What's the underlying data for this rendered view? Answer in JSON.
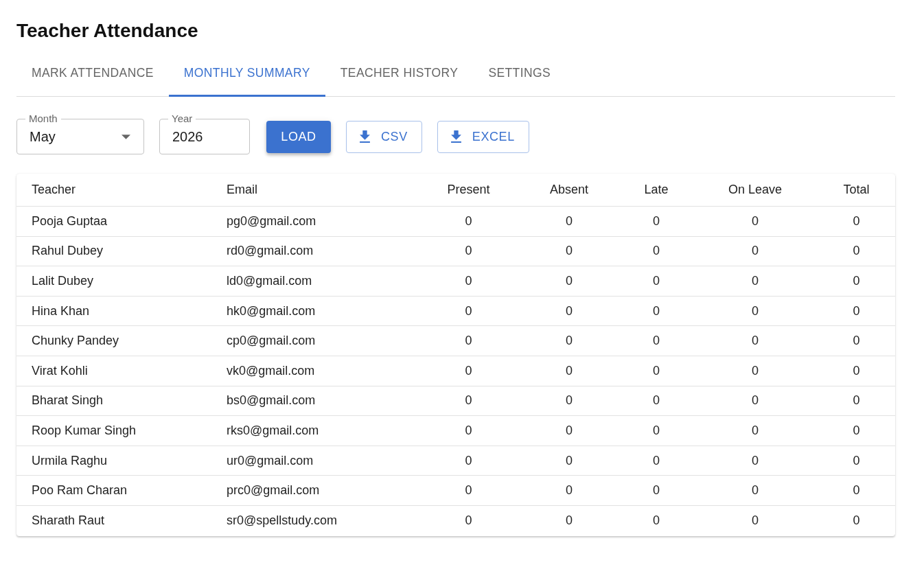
{
  "title": "Teacher Attendance",
  "tabs": [
    {
      "label": "MARK ATTENDANCE",
      "selected": false
    },
    {
      "label": "MONTHLY SUMMARY",
      "selected": true
    },
    {
      "label": "TEACHER HISTORY",
      "selected": false
    },
    {
      "label": "SETTINGS",
      "selected": false
    }
  ],
  "filters": {
    "month": {
      "label": "Month",
      "value": "May"
    },
    "year": {
      "label": "Year",
      "value": "2026"
    }
  },
  "buttons": [
    {
      "label": "LOAD",
      "kind": "primary"
    },
    {
      "label": "CSV",
      "kind": "download"
    },
    {
      "label": "EXCEL",
      "kind": "download"
    }
  ],
  "table": {
    "columns": [
      "Teacher",
      "Email",
      "Present",
      "Absent",
      "Late",
      "On Leave",
      "Total"
    ],
    "rows": [
      [
        "Pooja Guptaa",
        "pg0@gmail.com",
        "0",
        "0",
        "0",
        "0",
        "0"
      ],
      [
        "Rahul Dubey",
        "rd0@gmail.com",
        "0",
        "0",
        "0",
        "0",
        "0"
      ],
      [
        "Lalit Dubey",
        "ld0@gmail.com",
        "0",
        "0",
        "0",
        "0",
        "0"
      ],
      [
        "Hina Khan",
        "hk0@gmail.com",
        "0",
        "0",
        "0",
        "0",
        "0"
      ],
      [
        "Chunky Pandey",
        "cp0@gmail.com",
        "0",
        "0",
        "0",
        "0",
        "0"
      ],
      [
        "Virat Kohli",
        "vk0@gmail.com",
        "0",
        "0",
        "0",
        "0",
        "0"
      ],
      [
        "Bharat Singh",
        "bs0@gmail.com",
        "0",
        "0",
        "0",
        "0",
        "0"
      ],
      [
        "Roop Kumar Singh",
        "rks0@gmail.com",
        "0",
        "0",
        "0",
        "0",
        "0"
      ],
      [
        "Urmila Raghu",
        "ur0@gmail.com",
        "0",
        "0",
        "0",
        "0",
        "0"
      ],
      [
        "Poo Ram Charan",
        "prc0@gmail.com",
        "0",
        "0",
        "0",
        "0",
        "0"
      ],
      [
        "Sharath Raut",
        "sr0@spellstudy.com",
        "0",
        "0",
        "0",
        "0",
        "0"
      ]
    ]
  }
}
